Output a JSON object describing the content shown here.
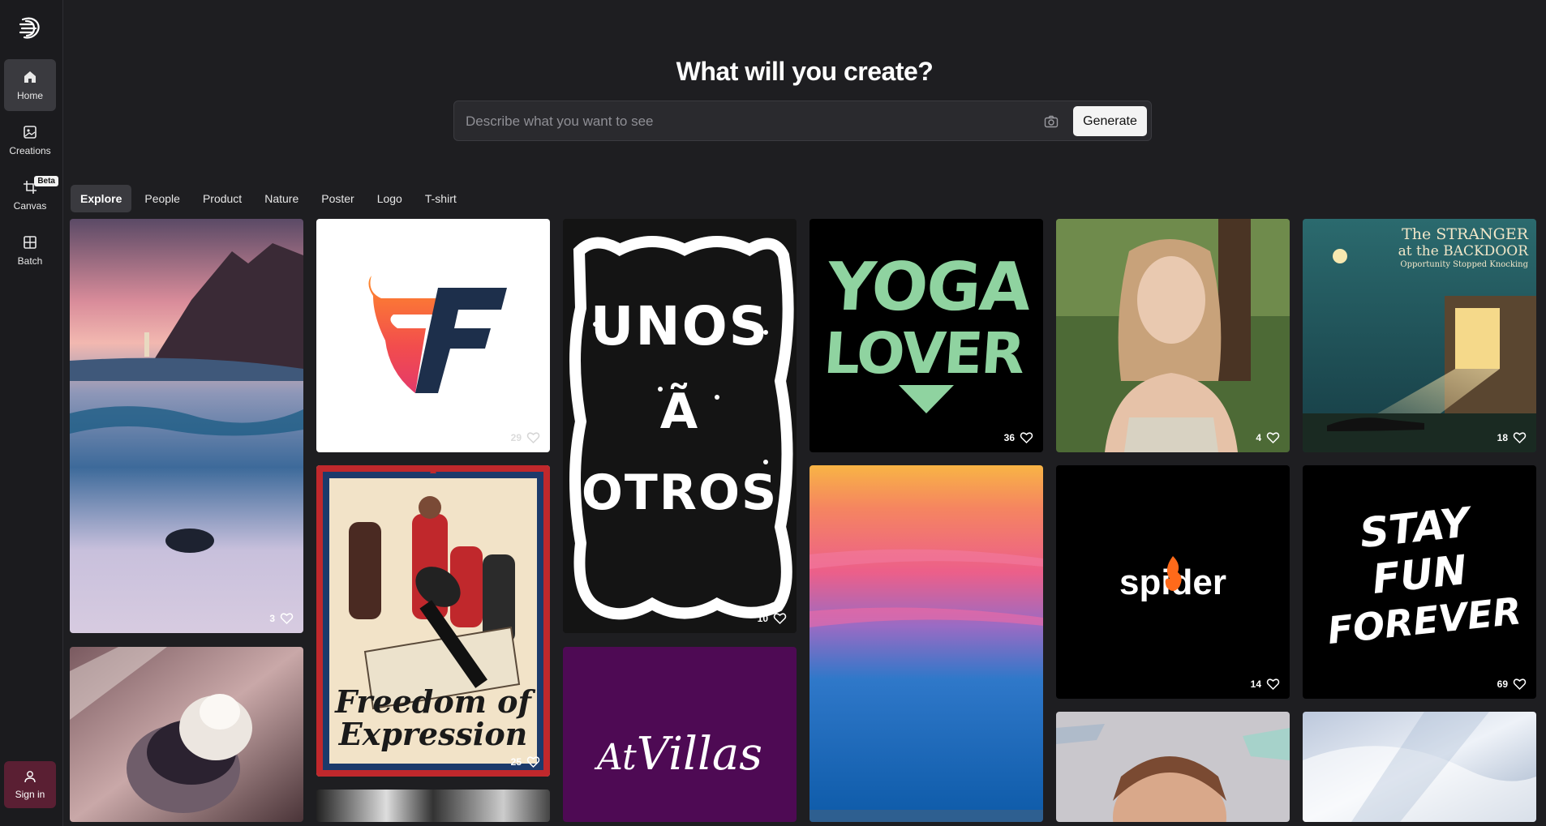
{
  "sidebar": {
    "items": [
      {
        "label": "Home",
        "icon": "home-icon"
      },
      {
        "label": "Creations",
        "icon": "image-icon"
      },
      {
        "label": "Canvas",
        "icon": "crop-icon",
        "badge": "Beta"
      },
      {
        "label": "Batch",
        "icon": "grid-image-icon"
      }
    ],
    "signin_label": "Sign in"
  },
  "header": {
    "title": "What will you create?",
    "search_placeholder": "Describe what you want to see",
    "generate_label": "Generate"
  },
  "tabs": [
    "Explore",
    "People",
    "Product",
    "Nature",
    "Poster",
    "Logo",
    "T-shirt"
  ],
  "cards": {
    "lighthouse": {
      "likes": "3"
    },
    "ff_logo": {
      "likes": "29"
    },
    "unos_a_otros": {
      "likes": "10",
      "text": [
        "UNOS",
        "Ã",
        "OTROS"
      ]
    },
    "yoga_lover": {
      "likes": "36",
      "text": [
        "YOGA",
        "LOVER"
      ]
    },
    "portrait": {
      "likes": "4"
    },
    "stranger": {
      "likes": "18",
      "title_line1": "The STRANGER",
      "title_line2": "at the BACKDOOR",
      "subtitle": "Opportunity Stopped Knocking"
    },
    "freedom": {
      "likes": "25",
      "text_line1": "Freedom of",
      "text_line2": "Expression"
    },
    "spider": {
      "likes": "14",
      "text": "spider"
    },
    "stay_fun": {
      "likes": "69",
      "text": [
        "STAY",
        "FUN",
        "FOREVER"
      ]
    },
    "villas": {
      "text_a": "At",
      "text_b": "Villas"
    }
  }
}
